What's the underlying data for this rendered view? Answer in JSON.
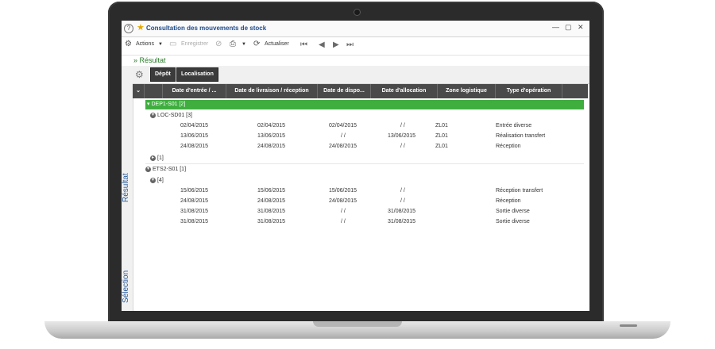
{
  "window": {
    "title": "Consultation des mouvements de stock"
  },
  "toolbar": {
    "actions": "Actions",
    "save": "Enregistrer",
    "refresh": "Actualiser"
  },
  "result_header": "Résultat",
  "side_tabs": {
    "result": "Résultat",
    "selection": "Sélection"
  },
  "grid_buttons": {
    "depot": "Dépôt",
    "localisation": "Localisation"
  },
  "columns": [
    "Date d'entrée / ...",
    "Date de livraison / réception",
    "Date de dispo...",
    "Date d'allocation",
    "Zone logistique",
    "Type d'opération"
  ],
  "groups": {
    "g1": "DEP1-S01 [2]",
    "g1a": "LOC-SD01 [3]",
    "g1b": "[1]",
    "g2": "ETS2-S01 [1]",
    "g2a": "[4]"
  },
  "rows_a": [
    [
      "02/04/2015",
      "02/04/2015",
      "02/04/2015",
      "/ /",
      "ZL01",
      "Entrée diverse"
    ],
    [
      "13/06/2015",
      "13/06/2015",
      "/ /",
      "13/06/2015",
      "ZL01",
      "Réalisation transfert"
    ],
    [
      "24/08/2015",
      "24/08/2015",
      "24/08/2015",
      "/ /",
      "ZL01",
      "Réception"
    ]
  ],
  "rows_b": [
    [
      "15/06/2015",
      "15/06/2015",
      "15/06/2015",
      "/ /",
      "",
      "Réception transfert"
    ],
    [
      "24/08/2015",
      "24/08/2015",
      "24/08/2015",
      "/ /",
      "",
      "Réception"
    ],
    [
      "31/08/2015",
      "31/08/2015",
      "/ /",
      "31/08/2015",
      "",
      "Sortie diverse"
    ],
    [
      "31/08/2015",
      "31/08/2015",
      "/ /",
      "31/08/2015",
      "",
      "Sortie diverse"
    ]
  ]
}
